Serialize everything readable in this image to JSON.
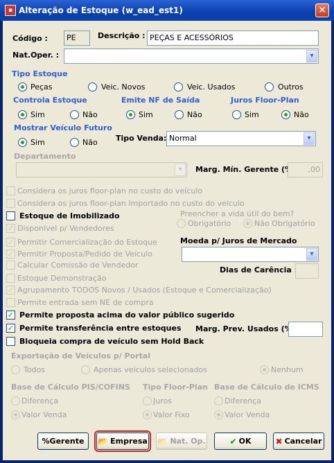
{
  "window": {
    "title": "Alteração de Estoque (w_ead_est1)",
    "close_glyph": "✕"
  },
  "header": {
    "codigo_label": "Código :",
    "codigo_value": "PE",
    "descricao_label": "Descrição :",
    "descricao_value": "PEÇAS E ACESSÓRIOS",
    "natoper_label": "Nat.Oper. :",
    "natoper_value": ""
  },
  "tipo_estoque": {
    "title": "Tipo Estoque",
    "options": [
      "Peças",
      "Veic. Novos",
      "Veic. Usados",
      "Outros"
    ],
    "selected": "Peças"
  },
  "controla_estoque": {
    "title": "Controla Estoque",
    "sim": "Sim",
    "nao": "Não",
    "selected": "Sim"
  },
  "emite_nf": {
    "title": "Emite NF de Saída",
    "sim": "Sim",
    "nao": "Não",
    "selected": "Sim"
  },
  "juros_floor": {
    "title": "Juros Floor-Plan",
    "sim": "Sim",
    "nao": "Não",
    "selected": "Não"
  },
  "mostrar_veiculo": {
    "title": "Mostrar Veículo Futuro",
    "sim": "Sim",
    "nao": "Não",
    "selected": "Sim"
  },
  "tipo_venda": {
    "label": "Tipo Venda:",
    "value": "Normal"
  },
  "departamento": {
    "title": "Departamento",
    "value": "",
    "margem_label": "Marg. Mín. Gerente (%):",
    "margem_value": ",00"
  },
  "checks": {
    "c1": "Considera os juros floor-plan no custo do veículo",
    "c2": "Considera os juros floor-plan Importado no custo do veículo",
    "c3": "Estoque de Imobilizado",
    "c4": "Disponível p/ Vendedores",
    "c5": "Permitir Comercialização do Estoque",
    "c6": "Permitir Proposta/Pedido de Veículo",
    "c7": "Calcular Comissão de Vendedor",
    "c8": "Estoque Demonstração",
    "c9": "Agrupamento TODOS Novos / Usados (Estoque e Comercialização)",
    "c10": "Permite entrada sem NE de compra",
    "c11": "Permite proposta acima do valor público sugerido",
    "c12": "Permite transferência entre estoques",
    "c13": "Bloqueia compra de veículo sem Hold Back",
    "check_glyph": "✓"
  },
  "vida_util": {
    "title": "Preencher a vida útil do bem?",
    "obrigatorio": "Obrigatório",
    "nao_obrigatorio": "Não Obrigatório"
  },
  "moeda": {
    "label": "Moeda p/ Juros de Mercado",
    "value": "",
    "dias_label": "Dias de Carência :",
    "dias_value": ""
  },
  "margem_prev": {
    "label": "Marg. Prev. Usados (%):",
    "value": ""
  },
  "exportacao": {
    "title": "Exportação de Veículos p/ Portal",
    "todos": "Todos",
    "apenas": "Apenas veículos selecionados",
    "nenhum": "Nenhum"
  },
  "base_pis": {
    "title": "Base de Cálculo PIS/COFINS",
    "diferenca": "Diferença",
    "valor_venda": "Valor Venda"
  },
  "tipo_floor": {
    "title": "Tipo Floor-Plan",
    "juros": "Juros",
    "valor_fixo": "Valor Fixo"
  },
  "base_icms": {
    "title": "Base de Cálculo de ICMS",
    "diferenca": "Diferença",
    "valor_venda": "Valor Venda"
  },
  "buttons": {
    "gerente": "%Gerente",
    "empresa": "Empresa",
    "natop": "Nat. Op.",
    "ok": "OK",
    "cancelar": "Cancelar"
  },
  "icons": {
    "dropdown": "▾",
    "folder": "📂",
    "ok": "✔",
    "cancel": "✖"
  }
}
